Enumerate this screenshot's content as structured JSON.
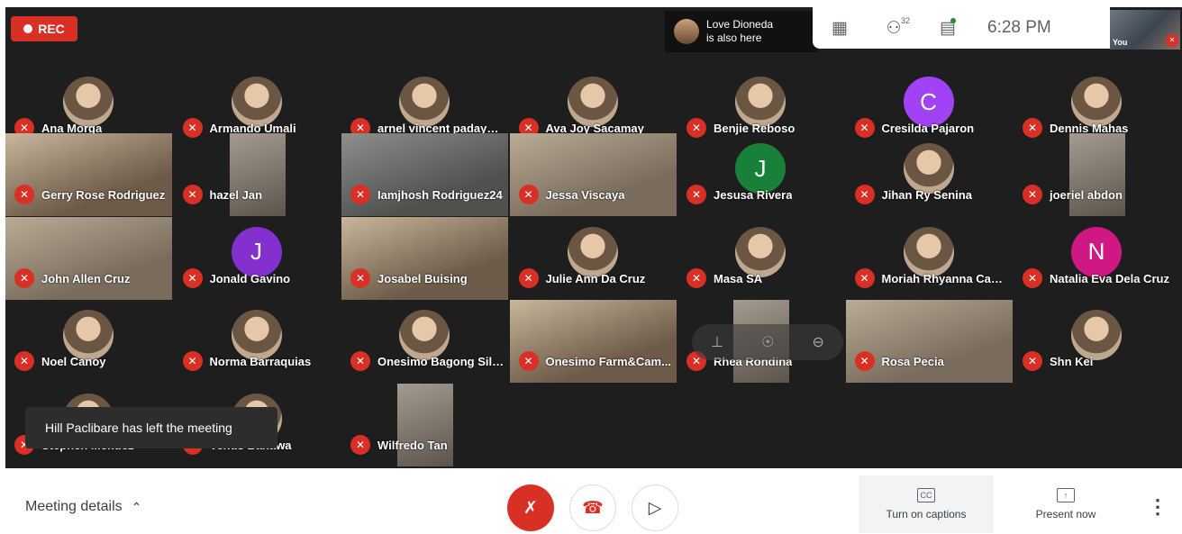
{
  "recording": {
    "label": "REC"
  },
  "notice": {
    "line1": "Love Dioneda",
    "line2": "is also here"
  },
  "topbar": {
    "layout_icon": "grid-icon",
    "people_count": "32",
    "chat_icon": "chat-icon",
    "time": "6:28 PM"
  },
  "self_view": {
    "label": "You"
  },
  "participants": [
    {
      "name": "Ana Morga",
      "type": "photo"
    },
    {
      "name": "Armando Umali",
      "type": "photo"
    },
    {
      "name": "arnel vincent padayhag",
      "type": "photo"
    },
    {
      "name": "Ava Joy Sacamay",
      "type": "photo"
    },
    {
      "name": "Benjie Reboso",
      "type": "photo"
    },
    {
      "name": "Cresilda Pajaron",
      "type": "letter",
      "letter": "C",
      "color": "#a142f4"
    },
    {
      "name": "Dennis Mahas",
      "type": "photo"
    },
    {
      "name": "Gerry Rose Rodriguez",
      "type": "video"
    },
    {
      "name": "hazel Jan",
      "type": "narrow"
    },
    {
      "name": "Iamjhosh Rodriguez24",
      "type": "video"
    },
    {
      "name": "Jessa Viscaya",
      "type": "video"
    },
    {
      "name": "Jesusa Rivera",
      "type": "letter",
      "letter": "J",
      "color": "#188038"
    },
    {
      "name": "Jihan Ry Senina",
      "type": "photo"
    },
    {
      "name": "joeriel abdon",
      "type": "narrow"
    },
    {
      "name": "John Allen Cruz",
      "type": "video"
    },
    {
      "name": "Jonald Gavino",
      "type": "letter",
      "letter": "J",
      "color": "#8430ce"
    },
    {
      "name": "Josabel Buising",
      "type": "video"
    },
    {
      "name": "Julie Ann Da Cruz",
      "type": "photo"
    },
    {
      "name": "Masa SA",
      "type": "photo"
    },
    {
      "name": "Moriah Rhyanna Cant...",
      "type": "photo"
    },
    {
      "name": "Natalia Eva Dela Cruz",
      "type": "letter",
      "letter": "N",
      "color": "#d01884"
    },
    {
      "name": "Noel Canoy",
      "type": "photo"
    },
    {
      "name": "Norma Barraquias",
      "type": "photo"
    },
    {
      "name": "Onesimo Bagong Sila...",
      "type": "photo"
    },
    {
      "name": "Onesimo Farm&Cam...",
      "type": "video"
    },
    {
      "name": "Rhea Rondina",
      "type": "narrow"
    },
    {
      "name": "Rosa Pecia",
      "type": "video"
    },
    {
      "name": "Shn Kei",
      "type": "photo"
    },
    {
      "name": "Stephen Mendez",
      "type": "photo"
    },
    {
      "name": "Venus Banawa",
      "type": "photo"
    },
    {
      "name": "Wilfredo Tan",
      "type": "narrow"
    }
  ],
  "toast": {
    "text": "Hill Paclibare has left the meeting"
  },
  "bottom": {
    "meeting_details": "Meeting details",
    "captions_label": "Turn on captions",
    "captions_icon": "CC",
    "present_label": "Present now",
    "more_icon": "more-vert-icon"
  }
}
